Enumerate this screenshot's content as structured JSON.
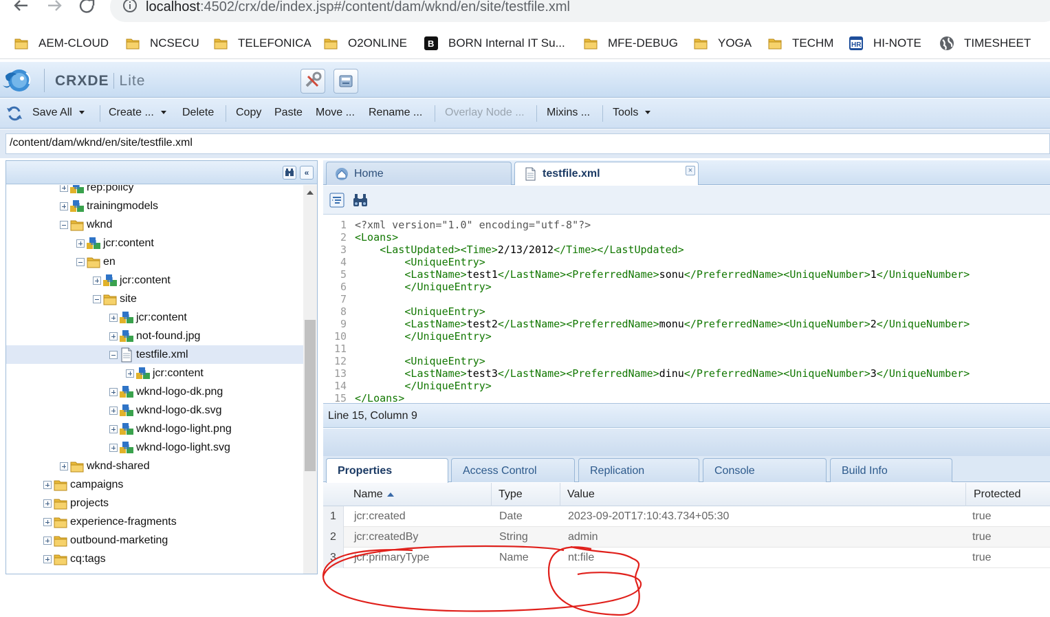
{
  "browser": {
    "url_host": "localhost",
    "url_path": ":4502/crx/de/index.jsp#/content/dam/wknd/en/site/testfile.xml"
  },
  "bookmarks": [
    {
      "label": "AEM-CLOUD",
      "icon": "folder-icon"
    },
    {
      "label": "NCSECU",
      "icon": "folder-icon"
    },
    {
      "label": "TELEFONICA",
      "icon": "folder-icon"
    },
    {
      "label": "O2ONLINE",
      "icon": "folder-icon"
    },
    {
      "label": "BORN Internal IT Su...",
      "icon": "born-logo-icon"
    },
    {
      "label": "MFE-DEBUG",
      "icon": "folder-icon"
    },
    {
      "label": "YOGA",
      "icon": "folder-icon"
    },
    {
      "label": "TECHM",
      "icon": "folder-icon"
    },
    {
      "label": "HI-NOTE",
      "icon": "hr-logo-icon"
    },
    {
      "label": "TIMESHEET",
      "icon": "globe-icon"
    }
  ],
  "app": {
    "title": "CRXDE",
    "subtitle": "Lite"
  },
  "toolbar": {
    "save_all": "Save All",
    "create": "Create ...",
    "delete": "Delete",
    "copy": "Copy",
    "paste": "Paste",
    "move": "Move ...",
    "rename": "Rename ...",
    "overlay_node": "Overlay Node ...",
    "mixins": "Mixins ...",
    "tools": "Tools"
  },
  "path": "/content/dam/wknd/en/site/testfile.xml",
  "tree": [
    {
      "label": "rep:policy",
      "icon": "node-icon",
      "toggle": "plus",
      "level": 0
    },
    {
      "label": "trainingmodels",
      "icon": "node-icon",
      "toggle": "plus",
      "level": 0
    },
    {
      "label": "wknd",
      "icon": "folder-icon",
      "toggle": "minus",
      "level": 0
    },
    {
      "label": "jcr:content",
      "icon": "node-icon",
      "toggle": "plus",
      "level": 1
    },
    {
      "label": "en",
      "icon": "folder-icon",
      "toggle": "minus",
      "level": 1
    },
    {
      "label": "jcr:content",
      "icon": "node-icon",
      "toggle": "plus",
      "level": 2
    },
    {
      "label": "site",
      "icon": "folder-icon",
      "toggle": "minus",
      "level": 2
    },
    {
      "label": "jcr:content",
      "icon": "node-icon",
      "toggle": "plus",
      "level": 3
    },
    {
      "label": "not-found.jpg",
      "icon": "node-icon",
      "toggle": "plus",
      "level": 3
    },
    {
      "label": "testfile.xml",
      "icon": "file-icon",
      "toggle": "minus",
      "level": 3,
      "selected": true
    },
    {
      "label": "jcr:content",
      "icon": "node-icon",
      "toggle": "plus",
      "level": 4
    },
    {
      "label": "wknd-logo-dk.png",
      "icon": "node-icon",
      "toggle": "plus",
      "level": 3
    },
    {
      "label": "wknd-logo-dk.svg",
      "icon": "node-icon",
      "toggle": "plus",
      "level": 3
    },
    {
      "label": "wknd-logo-light.png",
      "icon": "node-icon",
      "toggle": "plus",
      "level": 3
    },
    {
      "label": "wknd-logo-light.svg",
      "icon": "node-icon",
      "toggle": "plus",
      "level": 3
    },
    {
      "label": "wknd-shared",
      "icon": "folder-icon",
      "toggle": "plus",
      "level": 0
    },
    {
      "label": "campaigns",
      "icon": "folder-icon",
      "toggle": "plus",
      "level": -1
    },
    {
      "label": "projects",
      "icon": "folder-icon",
      "toggle": "plus",
      "level": -1
    },
    {
      "label": "experience-fragments",
      "icon": "folder-icon",
      "toggle": "plus",
      "level": -1
    },
    {
      "label": "outbound-marketing",
      "icon": "folder-icon",
      "toggle": "plus",
      "level": -1
    },
    {
      "label": "cq:tags",
      "icon": "folder-icon",
      "toggle": "plus",
      "level": -1
    }
  ],
  "editor_tabs": {
    "home": "Home",
    "file": "testfile.xml"
  },
  "code_lines": [
    {
      "n": "1",
      "indent": 0,
      "parts": [
        [
          "pi",
          "<?xml version=\"1.0\" encoding=\"utf-8\"?>"
        ]
      ]
    },
    {
      "n": "2",
      "indent": 0,
      "parts": [
        [
          "tag",
          "<Loans>"
        ]
      ]
    },
    {
      "n": "3",
      "indent": 4,
      "parts": [
        [
          "tag",
          "<LastUpdated><Time>"
        ],
        [
          "txt",
          "2/13/2012"
        ],
        [
          "tag",
          "</Time></LastUpdated>"
        ]
      ]
    },
    {
      "n": "4",
      "indent": 8,
      "parts": [
        [
          "tag",
          "<UniqueEntry>"
        ]
      ]
    },
    {
      "n": "5",
      "indent": 8,
      "parts": [
        [
          "tag",
          "<LastName>"
        ],
        [
          "txt",
          "test1"
        ],
        [
          "tag",
          "</LastName><PreferredName>"
        ],
        [
          "txt",
          "sonu"
        ],
        [
          "tag",
          "</PreferredName><UniqueNumber>"
        ],
        [
          "txt",
          "1"
        ],
        [
          "tag",
          "</UniqueNumber>"
        ]
      ]
    },
    {
      "n": "6",
      "indent": 8,
      "parts": [
        [
          "tag",
          "</UniqueEntry>"
        ]
      ]
    },
    {
      "n": "7",
      "indent": 0,
      "parts": []
    },
    {
      "n": "8",
      "indent": 8,
      "parts": [
        [
          "tag",
          "<UniqueEntry>"
        ]
      ]
    },
    {
      "n": "9",
      "indent": 8,
      "parts": [
        [
          "tag",
          "<LastName>"
        ],
        [
          "txt",
          "test2"
        ],
        [
          "tag",
          "</LastName><PreferredName>"
        ],
        [
          "txt",
          "monu"
        ],
        [
          "tag",
          "</PreferredName><UniqueNumber>"
        ],
        [
          "txt",
          "2"
        ],
        [
          "tag",
          "</UniqueNumber>"
        ]
      ]
    },
    {
      "n": "10",
      "indent": 8,
      "parts": [
        [
          "tag",
          "</UniqueEntry>"
        ]
      ]
    },
    {
      "n": "11",
      "indent": 0,
      "parts": []
    },
    {
      "n": "12",
      "indent": 8,
      "parts": [
        [
          "tag",
          "<UniqueEntry>"
        ]
      ]
    },
    {
      "n": "13",
      "indent": 8,
      "parts": [
        [
          "tag",
          "<LastName>"
        ],
        [
          "txt",
          "test3"
        ],
        [
          "tag",
          "</LastName><PreferredName>"
        ],
        [
          "txt",
          "dinu"
        ],
        [
          "tag",
          "</PreferredName><UniqueNumber>"
        ],
        [
          "txt",
          "3"
        ],
        [
          "tag",
          "</UniqueNumber>"
        ]
      ]
    },
    {
      "n": "14",
      "indent": 8,
      "parts": [
        [
          "tag",
          "</UniqueEntry>"
        ]
      ]
    },
    {
      "n": "15",
      "indent": 0,
      "parts": [
        [
          "tag",
          "</Loans>"
        ]
      ]
    }
  ],
  "status": "Line 15, Column 9",
  "bottom_tabs": [
    "Properties",
    "Access Control",
    "Replication",
    "Console",
    "Build Info"
  ],
  "properties": {
    "headers": {
      "name": "Name",
      "type": "Type",
      "value": "Value",
      "protected": "Protected"
    },
    "rows": [
      {
        "n": "1",
        "name": "jcr:created",
        "type": "Date",
        "value": "2023-09-20T17:10:43.734+05:30",
        "protected": "true"
      },
      {
        "n": "2",
        "name": "jcr:createdBy",
        "type": "String",
        "value": "admin",
        "protected": "true"
      },
      {
        "n": "3",
        "name": "jcr:primaryType",
        "type": "Name",
        "value": "nt:file",
        "protected": "true"
      }
    ]
  },
  "colors": {
    "annotation": "#e0201b",
    "accent": "#2d5a8c"
  }
}
